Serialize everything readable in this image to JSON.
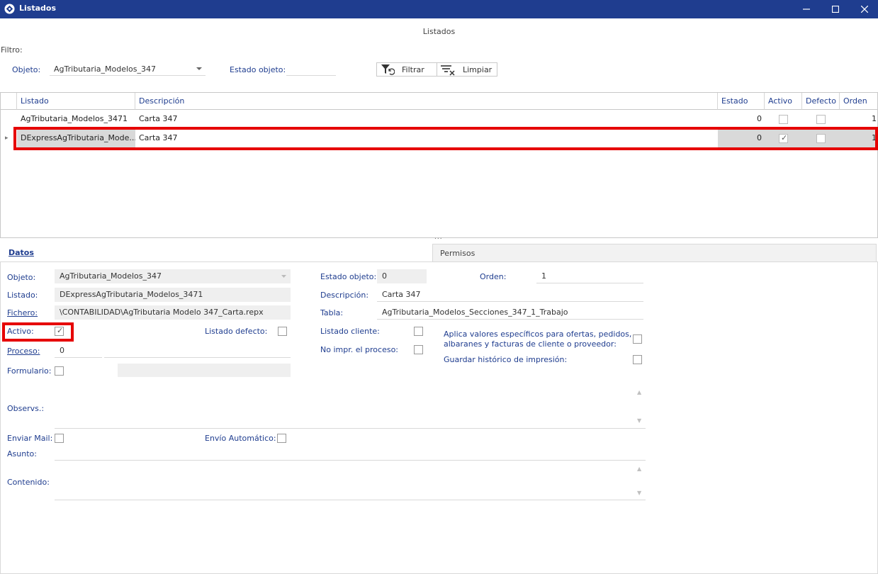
{
  "window": {
    "title": "Listados",
    "minimize": "─",
    "maximize": "☐",
    "close": "✕"
  },
  "form_title": "Listados",
  "filter": {
    "label": "Filtro:",
    "objeto_label": "Objeto:",
    "objeto_value": "AgTributaria_Modelos_347",
    "estado_label": "Estado objeto:",
    "estado_value": "",
    "filtrar_label": "Filtrar",
    "limpiar_label": "Limpiar"
  },
  "grid": {
    "headers": [
      "Listado",
      "Descripción",
      "Estado",
      "Activo",
      "Defecto",
      "Orden"
    ],
    "rows": [
      {
        "listado": "AgTributaria_Modelos_3471",
        "descripcion": "Carta 347",
        "estado": "0",
        "activo": false,
        "defecto": false,
        "orden": "1"
      },
      {
        "listado": "DExpressAgTributaria_Mode...",
        "descripcion": "Carta 347",
        "estado": "0",
        "activo": true,
        "defecto": false,
        "orden": "1"
      }
    ],
    "row_indicator": "▸"
  },
  "splitter": "...",
  "tabs": {
    "datos": "Datos",
    "permisos": "Permisos"
  },
  "detail": {
    "objeto_label": "Objeto:",
    "objeto_value": "AgTributaria_Modelos_347",
    "listado_label": "Listado:",
    "listado_value": "DExpressAgTributaria_Modelos_3471",
    "fichero_label": "Fichero:",
    "fichero_value": "\\CONTABILIDAD\\AgTributaria Modelo 347_Carta.repx",
    "activo_label": "Activo:",
    "activo_checked": true,
    "listado_defecto_label": "Listado defecto:",
    "proceso_label": "Proceso:",
    "proceso_value": "0",
    "formulario_label": "Formulario:",
    "observs_label": "Observs.:",
    "enviar_mail_label": "Enviar Mail:",
    "envio_automatico_label": "Envío Automático:",
    "asunto_label": "Asunto:",
    "contenido_label": "Contenido:",
    "estado_objeto_label": "Estado objeto:",
    "estado_objeto_value": "0",
    "orden_label": "Orden:",
    "orden_value": "1",
    "descripcion_label": "Descripción:",
    "descripcion_value": "Carta 347",
    "tabla_label": "Tabla:",
    "tabla_value": "AgTributaria_Modelos_Secciones_347_1_Trabajo",
    "listado_cliente_label": "Listado cliente:",
    "no_impr_label": "No impr. el proceso:",
    "aplica_label_1": "Aplica valores específicos para ofertas, pedidos,",
    "aplica_label_2": "albaranes y facturas de cliente o proveedor:",
    "guardar_label": "Guardar histórico de impresión:"
  },
  "colors": {
    "titlebar": "#1f3d8f",
    "label_blue": "#1f3d8f",
    "highlight_red": "#e60000",
    "selected_row": "#d9d9d9"
  }
}
